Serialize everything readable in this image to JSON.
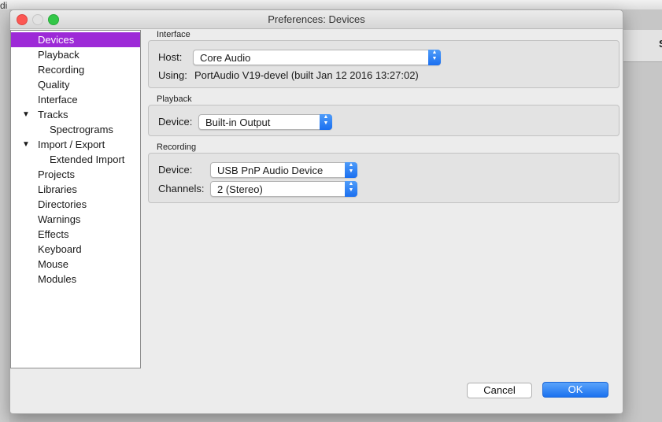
{
  "background": {
    "left_fragment": "di",
    "right_fragment": "S"
  },
  "dialog": {
    "title": "Preferences: Devices"
  },
  "sidebar": {
    "items": [
      {
        "label": "Devices",
        "selected": true
      },
      {
        "label": "Playback"
      },
      {
        "label": "Recording"
      },
      {
        "label": "Quality"
      },
      {
        "label": "Interface"
      },
      {
        "label": "Tracks",
        "expanded": true
      },
      {
        "label": "Spectrograms",
        "child": true
      },
      {
        "label": "Import / Export",
        "expanded": true
      },
      {
        "label": "Extended Import",
        "child": true
      },
      {
        "label": "Projects"
      },
      {
        "label": "Libraries"
      },
      {
        "label": "Directories"
      },
      {
        "label": "Warnings"
      },
      {
        "label": "Effects"
      },
      {
        "label": "Keyboard"
      },
      {
        "label": "Mouse"
      },
      {
        "label": "Modules"
      }
    ],
    "expand_glyph": "▼"
  },
  "interface_group": {
    "title": "Interface",
    "host_label": "Host:",
    "host_value": "Core Audio",
    "using_label": "Using:",
    "using_value": "PortAudio V19-devel (built Jan 12 2016 13:27:02)"
  },
  "playback_group": {
    "title": "Playback",
    "device_label": "Device:",
    "device_value": "Built-in Output"
  },
  "recording_group": {
    "title": "Recording",
    "device_label": "Device:",
    "device_value": "USB PnP Audio Device",
    "channels_label": "Channels:",
    "channels_value": "2 (Stereo)"
  },
  "buttons": {
    "cancel": "Cancel",
    "ok": "OK"
  },
  "colors": {
    "selection": "#9d2ad7",
    "accent": "#1b72ef"
  }
}
